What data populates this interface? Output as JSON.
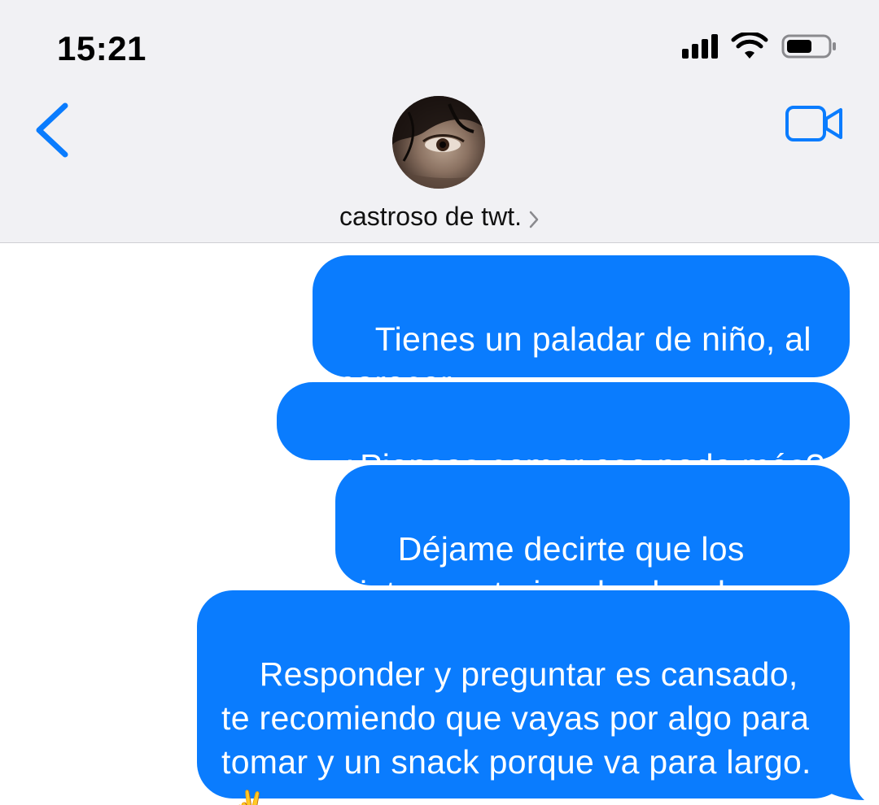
{
  "status_bar": {
    "time": "15:21",
    "icons": [
      "cellular-signal-icon",
      "wifi-icon",
      "battery-icon"
    ]
  },
  "nav": {
    "back_icon": "chevron-left-icon",
    "video_icon": "video-camera-icon",
    "contact_name": "castroso de twt.",
    "contact_chevron_icon": "chevron-right-icon",
    "avatar": "contact-avatar-photo"
  },
  "colors": {
    "accent": "#0a7cfe",
    "header_bg": "#f1f1f4"
  },
  "messages": [
    {
      "text": "Tienes un paladar de niño, al parecer."
    },
    {
      "text": "¿Piensas comer eso nada más?"
    },
    {
      "text": "Déjame decirte que los interrogatorios dan hambre."
    },
    {
      "text": "Responder y preguntar es cansado, te recomiendo que vayas por algo para tomar y un snack porque va para largo.",
      "emoji": "✌️"
    }
  ]
}
